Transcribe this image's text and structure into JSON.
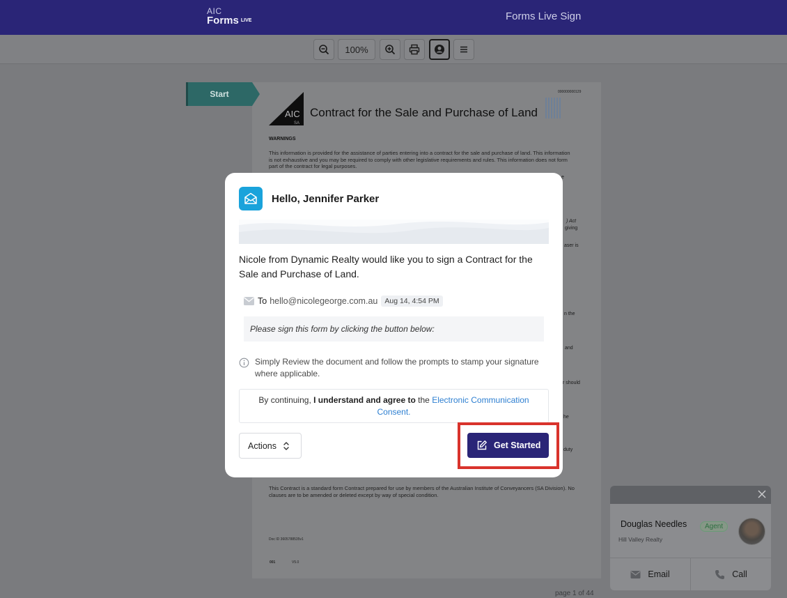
{
  "header": {
    "logo_line1": "AIC",
    "logo_line2": "Forms",
    "logo_badge": "LIVE",
    "title": "Forms Live Sign"
  },
  "toolbar": {
    "zoom_value": "100%",
    "buttons": [
      "zoom-out-icon",
      "zoom-in-icon",
      "print-icon",
      "user-circle-icon",
      "menu-icon"
    ]
  },
  "document": {
    "start_label": "Start",
    "code": "000000000129",
    "logo_text": "AIC",
    "logo_sub": "SA",
    "title": "Contract for the Sale and Purchase of Land",
    "warnings_heading": "WARNINGS",
    "warnings_text": "This information is provided for the assistance of parties entering into a contract for the sale and purchase of land. This information is not exhaustive and you may be required to comply with other legislative requirements and rules. This information does not form part of the contract for legal purposes.",
    "fragments": [
      "e",
      ") Act",
      "giving",
      "aser is",
      "n the",
      "and",
      "r should",
      "he",
      "duty"
    ],
    "footer_text": "This Contract is a standard form Contract prepared for use by members of the Australian Institute of Conveyancers (SA Division). No clauses are to be amended or deleted except by way of special condition.",
    "doc_id": "Doc ID 3605788535v1",
    "doc_num": "001",
    "doc_version": "V5.0",
    "page_indicator": "page 1 of 44"
  },
  "modal": {
    "greeting": "Hello, Jennifer Parker",
    "message": "Nicole from Dynamic Realty would like you to sign a Contract for the Sale and Purchase of Land.",
    "to_label": "To",
    "to_address": "hello@nicolegeorge.com.au",
    "sent_date": "Aug 14, 4:54 PM",
    "instruction": "Please sign this form by clicking the button below:",
    "info": "Simply Review the document and follow the prompts to stamp your signature where applicable.",
    "consent_prefix": "By continuing,",
    "consent_bold": "I understand and agree to",
    "consent_the": "the",
    "consent_link": "Electronic Communication Consent.",
    "actions_label": "Actions",
    "get_started_label": "Get Started"
  },
  "agent": {
    "name": "Douglas Needles",
    "badge": "Agent",
    "company": "Hill Valley Realty",
    "email_label": "Email",
    "call_label": "Call"
  },
  "colors": {
    "brand": "#2a2577",
    "accent": "#1aa3db",
    "link": "#2d7fd1",
    "highlight": "#d9332c"
  }
}
